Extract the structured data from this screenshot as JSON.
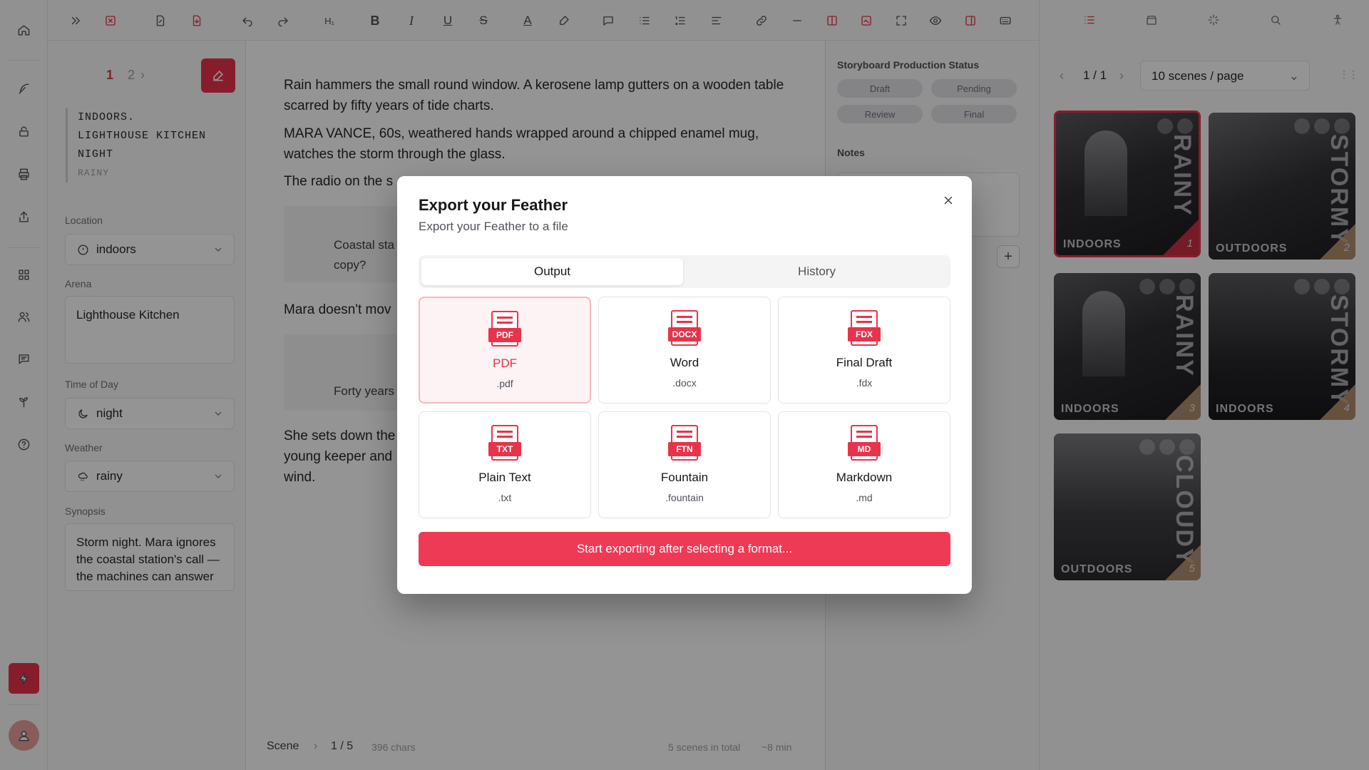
{
  "sidebar": {
    "pages": [
      "1",
      "2"
    ],
    "slug": {
      "location": "INDOORS.",
      "place": "LIGHTHOUSE KITCHEN",
      "time": "NIGHT",
      "weather": "RAINY"
    },
    "location": {
      "label": "Location",
      "value": "indoors"
    },
    "arena": {
      "label": "Arena",
      "value": "Lighthouse Kitchen"
    },
    "time_of_day": {
      "label": "Time of Day",
      "value": "night"
    },
    "weather": {
      "label": "Weather",
      "value": "rainy"
    },
    "synopsis": {
      "label": "Synopsis",
      "value": "Storm night. Mara ignores the coastal station's call — the machines can answer now."
    }
  },
  "editor": {
    "paragraphs": [
      "Rain hammers the small round window. A kerosene lamp gutters on a wooden table scarred by fifty years of tide charts.",
      "MARA VANCE, 60s, weathered hands wrapped around a chipped enamel mug, watches the storm through the glass.",
      "The radio on the s",
      "Mara doesn't mov",
      "She sets down the young keeper and wind."
    ],
    "dialogue": [
      "Coastal sta copy?",
      "Forty years"
    ],
    "footer": {
      "label": "Scene",
      "position": "1 / 5",
      "chars": "396 chars",
      "total": "5 scenes in total",
      "duration": "~8 min"
    }
  },
  "status_panel": {
    "title": "Storyboard Production Status",
    "chips": [
      "Draft",
      "Pending",
      "Review",
      "Final"
    ],
    "notes_label": "Notes"
  },
  "storyboard": {
    "pager": "1 / 1",
    "per_page": "10 scenes / page",
    "scenes": [
      {
        "num": "1",
        "tag": "INDOORS",
        "word": "RAINY"
      },
      {
        "num": "2",
        "tag": "OUTDOORS",
        "word": "STORMY"
      },
      {
        "num": "3",
        "tag": "INDOORS",
        "word": "RAINY"
      },
      {
        "num": "4",
        "tag": "INDOORS",
        "word": "STORMY"
      },
      {
        "num": "5",
        "tag": "OUTDOORS",
        "word": "CLOUDY"
      }
    ]
  },
  "modal": {
    "title": "Export your Feather",
    "subtitle": "Export your Feather to a file",
    "tabs": [
      "Output",
      "History"
    ],
    "formats": [
      {
        "badge": "PDF",
        "name": "PDF",
        "ext": ".pdf"
      },
      {
        "badge": "DOCX",
        "name": "Word",
        "ext": ".docx"
      },
      {
        "badge": "FDX",
        "name": "Final Draft",
        "ext": ".fdx"
      },
      {
        "badge": "TXT",
        "name": "Plain Text",
        "ext": ".txt"
      },
      {
        "badge": "FTN",
        "name": "Fountain",
        "ext": ".fountain"
      },
      {
        "badge": "MD",
        "name": "Markdown",
        "ext": ".md"
      }
    ],
    "export_label": "Start exporting after selecting a format..."
  },
  "colors": {
    "accent": "#e8334a",
    "accent_light": "#fdf2f4",
    "overlay": "rgba(0,0,0,0.42)"
  }
}
